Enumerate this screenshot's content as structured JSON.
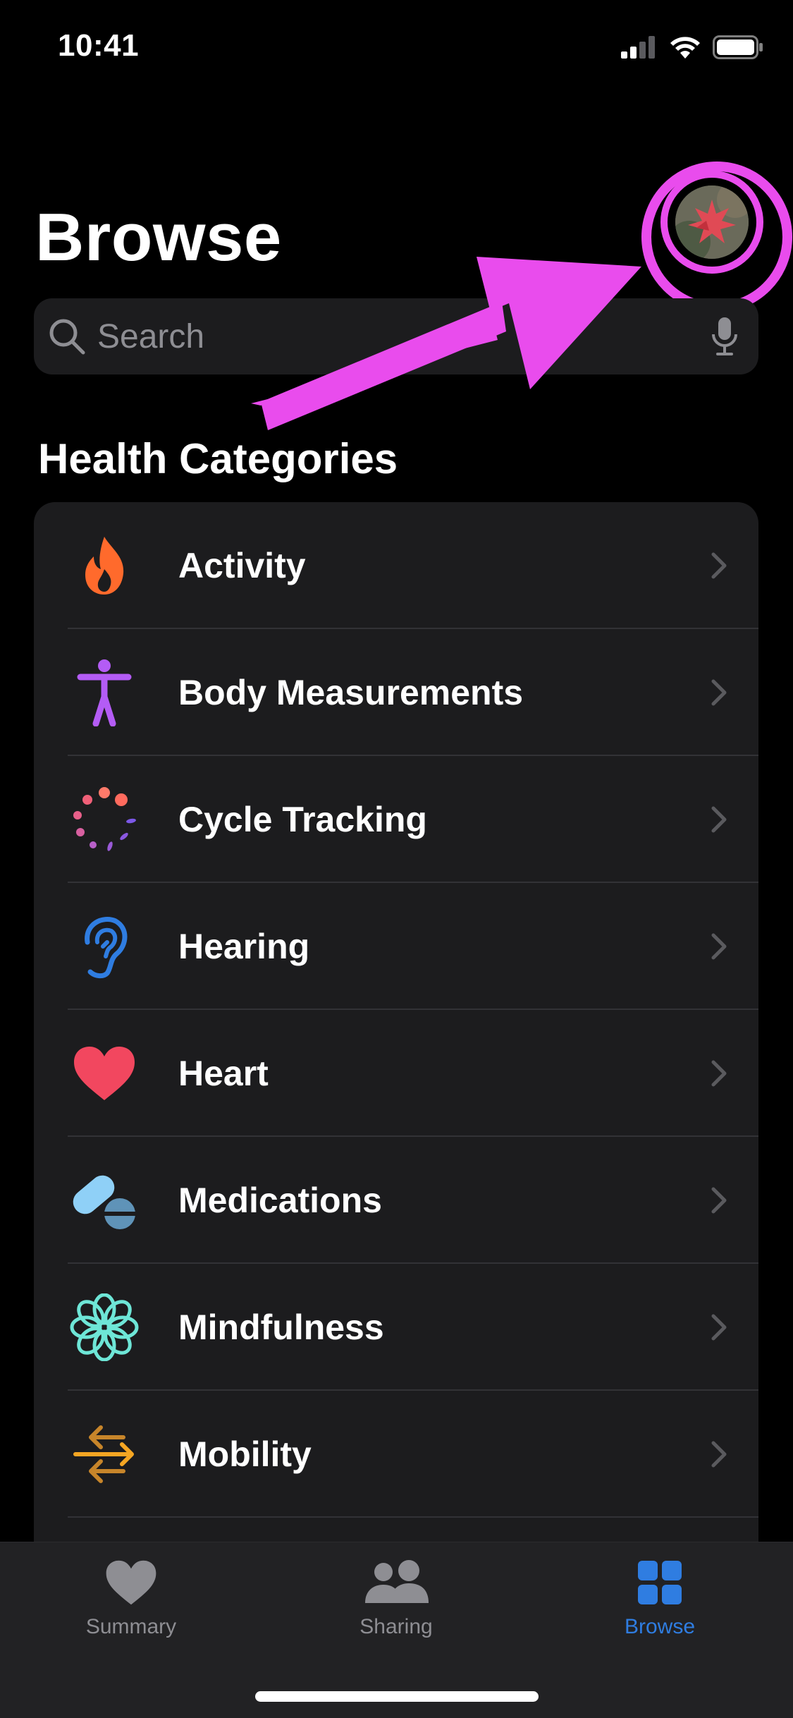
{
  "status_bar": {
    "time": "10:41"
  },
  "header": {
    "title": "Browse",
    "profile_icon": "profile-avatar"
  },
  "search": {
    "placeholder": "Search"
  },
  "section": {
    "title": "Health Categories"
  },
  "categories": [
    {
      "label": "Activity",
      "icon": "flame-icon",
      "color": "#ff6a2c"
    },
    {
      "label": "Body Measurements",
      "icon": "figure-icon",
      "color": "#b45cf5"
    },
    {
      "label": "Cycle Tracking",
      "icon": "cycle-icon",
      "color": "#ff6b6b"
    },
    {
      "label": "Hearing",
      "icon": "ear-icon",
      "color": "#2f7de1"
    },
    {
      "label": "Heart",
      "icon": "heart-icon",
      "color": "#f2475f"
    },
    {
      "label": "Medications",
      "icon": "pills-icon",
      "color": "#8fd0f7"
    },
    {
      "label": "Mindfulness",
      "icon": "flower-icon",
      "color": "#6ee6d7"
    },
    {
      "label": "Mobility",
      "icon": "arrows-icon",
      "color": "#f5a623"
    }
  ],
  "tabs": [
    {
      "label": "Summary",
      "icon": "heart-icon",
      "active": false
    },
    {
      "label": "Sharing",
      "icon": "people-icon",
      "active": false
    },
    {
      "label": "Browse",
      "icon": "grid-icon",
      "active": true
    }
  ],
  "colors": {
    "accent": "#2f7de1",
    "annotation": "#e94ced",
    "background": "#000000",
    "card": "#1c1c1e"
  }
}
